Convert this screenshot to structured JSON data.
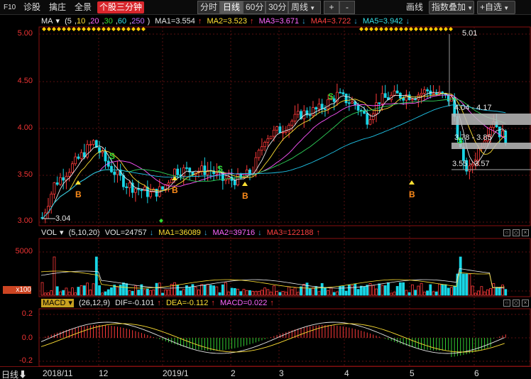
{
  "toolbar": {
    "f10": "F10",
    "diagnose": "诊股",
    "zhuangzhuang": "擒庄",
    "panorama": "全景",
    "three_min": "个股三分钟",
    "intraday": "分时",
    "daily": "日线",
    "min60": "60分",
    "min30": "30分",
    "weekly": "周线",
    "plus": "+",
    "minus": "-",
    "draw": "画线",
    "index_overlay": "指数叠加",
    "self_select": "+自选"
  },
  "ma_row": {
    "name": "MA",
    "params": [
      "5",
      "10",
      "20",
      "30",
      "60",
      "250"
    ],
    "ma1": "MA1=3.554",
    "ma2": "MA2=3.523",
    "ma3": "MA3=3.671",
    "ma4": "MA4=3.722",
    "ma5": "MA5=3.942"
  },
  "vol_row": {
    "name": "VOL",
    "params": "(5,10,20)",
    "vol": "VOL=24757",
    "ma1": "MA1=36089",
    "ma2": "MA2=39716",
    "ma3": "MA3=122188"
  },
  "macd_row": {
    "name": "MACD",
    "params": "(26,12,9)",
    "dif": "DIF=-0.101",
    "dea": "DEA=-0.112",
    "macd": "MACD=0.022"
  },
  "price_axis": [
    "5.00",
    "4.50",
    "4.00",
    "3.50",
    "3.00"
  ],
  "vol_axis": [
    "5000",
    "x100"
  ],
  "macd_axis": [
    "0.2",
    "0.0",
    "-0.2"
  ],
  "date_axis": [
    "2018/11",
    "12",
    "2019/1",
    "2",
    "3",
    "4",
    "5",
    "6"
  ],
  "bottom_tab": "日线",
  "annotations": {
    "high": "5.01",
    "low": "3.04",
    "zone1": "4.04 - 4.17",
    "zone2": "3.78 - 3.85",
    "zone3": "3.55 - 3.57"
  },
  "signals": {
    "buy": "B",
    "sell": "S"
  },
  "colors": {
    "up": "#ff3a3a",
    "down": "#19d6e6",
    "ma5": "#e8e8e8",
    "ma10": "#ffe033",
    "ma20": "#ff55ff",
    "ma30": "#2fd35a",
    "ma60": "#1fc4e8",
    "ma250": "#c070ff"
  }
}
